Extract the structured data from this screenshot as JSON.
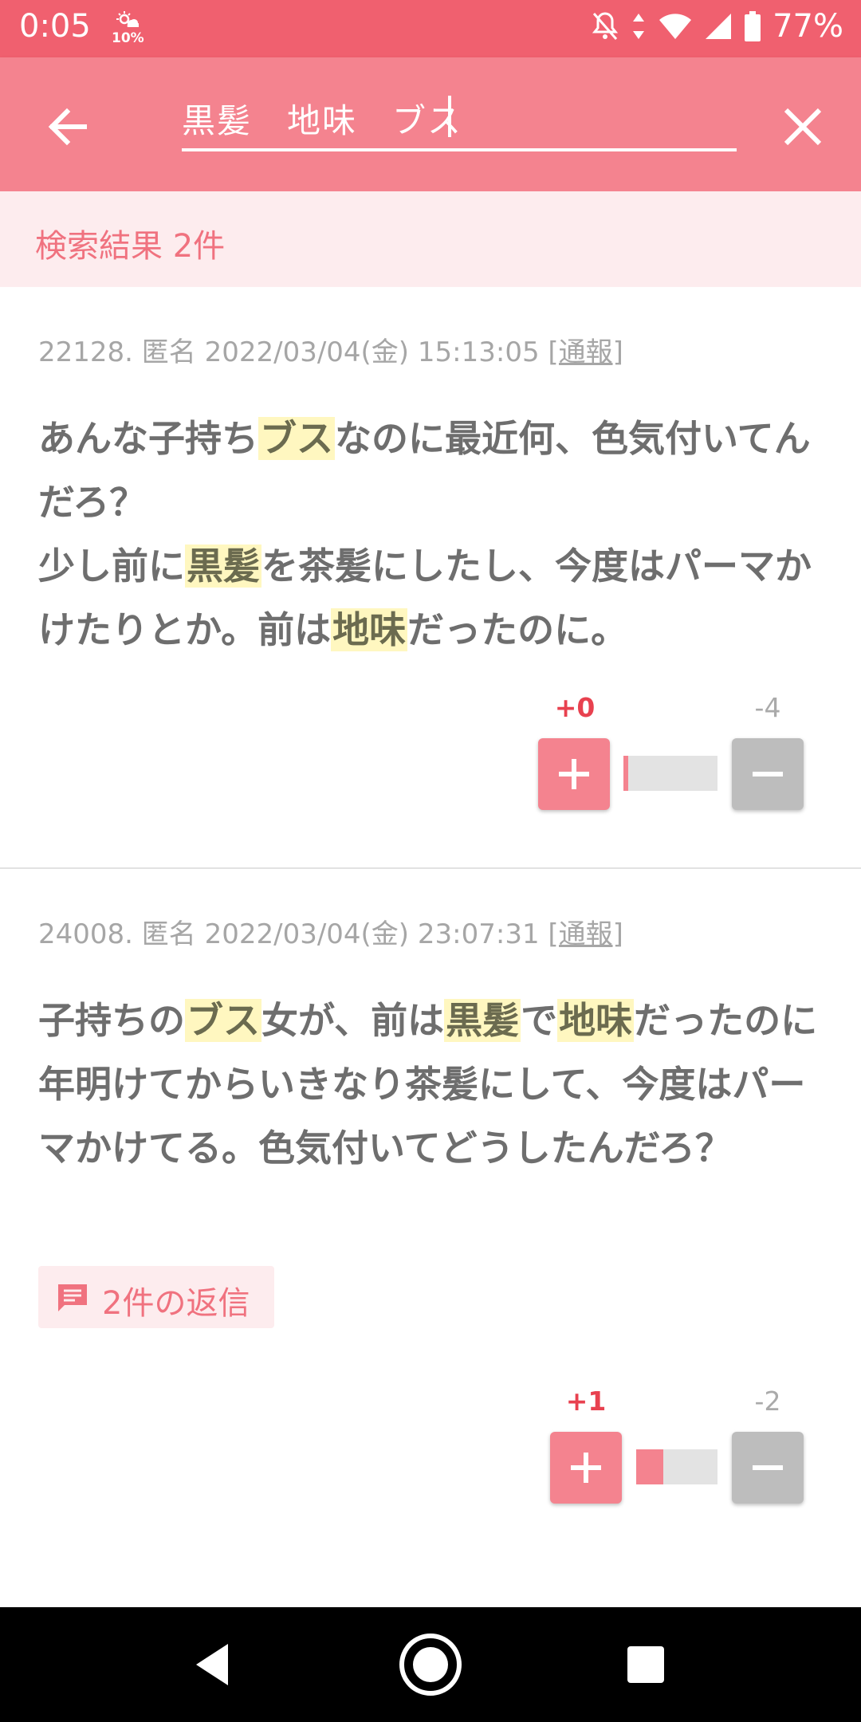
{
  "status_bar": {
    "time": "0:05",
    "weather_percent": "10%",
    "battery": "77%",
    "icons": [
      "sun-cloud-icon",
      "mute-icon",
      "data-arrows-icon",
      "wifi-icon",
      "cellular-icon",
      "battery-icon"
    ]
  },
  "app_bar": {
    "search_value": "黒髪　地味　ブス",
    "back_icon": "arrow-left-icon",
    "close_icon": "close-icon"
  },
  "result_count_text": "検索結果 2件",
  "posts": [
    {
      "meta": "22128. 匿名 2022/03/04(金) 15:13:05 ",
      "report": "[通報]",
      "body": [
        {
          "t": "あんな子持ち"
        },
        {
          "t": "ブス",
          "h": true
        },
        {
          "t": "なのに最近何、色気付いてんだろ？"
        },
        {
          "br": true
        },
        {
          "t": "少し前に"
        },
        {
          "t": "黒髪",
          "h": true
        },
        {
          "t": "を茶髪にしたし、今度はパーマかけたりとか。前は"
        },
        {
          "t": "地味",
          "h": true
        },
        {
          "t": "だったのに。"
        }
      ],
      "plus_count": "+0",
      "minus_count": "-4",
      "positive_fraction": 0.0
    },
    {
      "meta": "24008. 匿名 2022/03/04(金) 23:07:31 ",
      "report": "[通報]",
      "body": [
        {
          "t": "子持ちの"
        },
        {
          "t": "ブス",
          "h": true
        },
        {
          "t": "女が、前は"
        },
        {
          "t": "黒髪",
          "h": true
        },
        {
          "t": "で"
        },
        {
          "t": "地味",
          "h": true
        },
        {
          "t": "だったのに"
        },
        {
          "br": true
        },
        {
          "t": "年明けてからいきなり茶髪にして、今度はパーマかけてる。色気付いてどうしたんだろ？"
        }
      ],
      "reply_label": "2件の返信",
      "plus_count": "+1",
      "minus_count": "-2",
      "positive_fraction": 0.33
    }
  ],
  "colors": {
    "status_bar": "#f0606f",
    "app_bar": "#f4838f",
    "accent": "#f0727f",
    "highlight": "#fff7c0",
    "plus_count": "#e8414f"
  },
  "nav_bar": {
    "icons": [
      "back-triangle-icon",
      "home-circle-icon",
      "recents-square-icon"
    ]
  }
}
